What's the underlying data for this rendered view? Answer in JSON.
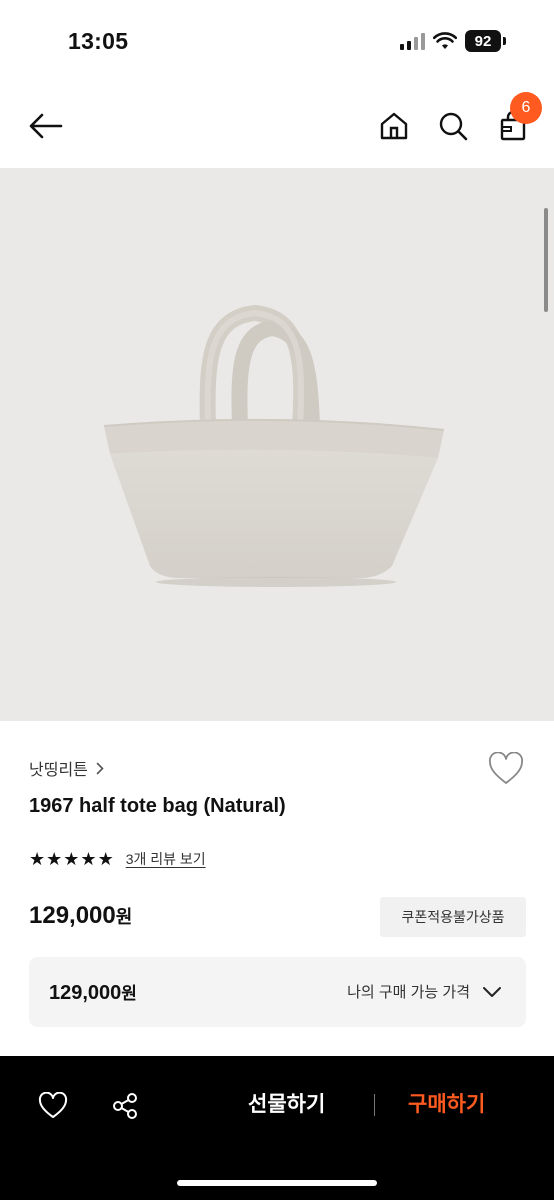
{
  "status_bar": {
    "time": "13:05",
    "battery": "92"
  },
  "header": {
    "cart_count": "6"
  },
  "product": {
    "brand": "낫띵리튼",
    "title": "1967 half tote bag (Natural)",
    "stars": [
      "★",
      "★",
      "★",
      "★",
      "★"
    ],
    "review_link": "3개 리뷰 보기",
    "price": "129,000",
    "currency": "원",
    "coupon_badge": "쿠폰적용불가상품"
  },
  "my_price": {
    "value": "129,000",
    "currency": "원",
    "label": "나의 구매 가능 가격"
  },
  "bottom_bar": {
    "gift_label": "선물하기",
    "buy_label": "구매하기"
  },
  "colors": {
    "accent": "#ff5a1f",
    "image_bg": "#ebe9e7",
    "bag": "#dcd9d3"
  },
  "icons": [
    "back-arrow-icon",
    "home-icon",
    "search-icon",
    "shopping-bag-icon",
    "heart-icon",
    "share-icon",
    "chevron-right-icon",
    "chevron-down-icon"
  ]
}
